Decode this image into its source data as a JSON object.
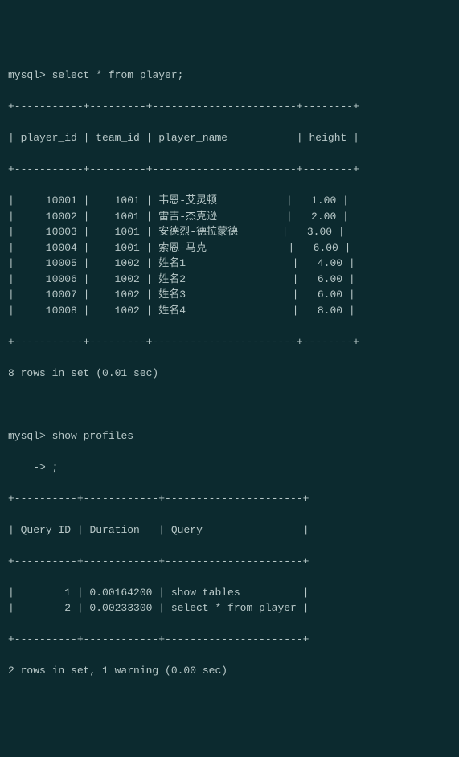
{
  "prompt": "mysql>",
  "continuation": "    ->",
  "queries": {
    "q1": "select * from player;",
    "q2": "show profiles",
    "q2_cont": ";"
  },
  "table1": {
    "headers": {
      "c1": "player_id",
      "c2": "team_id",
      "c3": "player_name",
      "c4": "height"
    },
    "rows": [
      {
        "c1": "10001",
        "c2": "1001",
        "c3": "韦恩-艾灵顿",
        "c4": "1.00"
      },
      {
        "c1": "10002",
        "c2": "1001",
        "c3": "雷吉-杰克逊",
        "c4": "2.00"
      },
      {
        "c1": "10003",
        "c2": "1001",
        "c3": "安德烈-德拉蒙德",
        "c4": "3.00"
      },
      {
        "c1": "10004",
        "c2": "1001",
        "c3": "索恩-马克",
        "c4": "6.00"
      },
      {
        "c1": "10005",
        "c2": "1002",
        "c3": "姓名1",
        "c4": "4.00"
      },
      {
        "c1": "10006",
        "c2": "1002",
        "c3": "姓名2",
        "c4": "6.00"
      },
      {
        "c1": "10007",
        "c2": "1002",
        "c3": "姓名3",
        "c4": "6.00"
      },
      {
        "c1": "10008",
        "c2": "1002",
        "c3": "姓名4",
        "c4": "8.00"
      }
    ],
    "summary": "8 rows in set (0.01 sec)"
  },
  "table2": {
    "headers": {
      "c1": "Query_ID",
      "c2": "Duration",
      "c3": "Query"
    },
    "rows": [
      {
        "c1": "1",
        "c2": "0.00164200",
        "c3": "show tables"
      },
      {
        "c1": "2",
        "c2": "0.00233300",
        "c3": "select * from player"
      }
    ],
    "summary": "2 rows in set, 1 warning (0.00 sec)"
  },
  "chart_data": {
    "type": "table",
    "tables": [
      {
        "title": "player",
        "columns": [
          "player_id",
          "team_id",
          "player_name",
          "height"
        ],
        "rows": [
          [
            10001,
            1001,
            "韦恩-艾灵顿",
            1.0
          ],
          [
            10002,
            1001,
            "雷吉-杰克逊",
            2.0
          ],
          [
            10003,
            1001,
            "安德烈-德拉蒙德",
            3.0
          ],
          [
            10004,
            1001,
            "索恩-马克",
            6.0
          ],
          [
            10005,
            1002,
            "姓名1",
            4.0
          ],
          [
            10006,
            1002,
            "姓名2",
            6.0
          ],
          [
            10007,
            1002,
            "姓名3",
            6.0
          ],
          [
            10008,
            1002,
            "姓名4",
            8.0
          ]
        ]
      },
      {
        "title": "profiles",
        "columns": [
          "Query_ID",
          "Duration",
          "Query"
        ],
        "rows": [
          [
            1,
            0.001642,
            "show tables"
          ],
          [
            2,
            0.002333,
            "select * from player"
          ]
        ]
      }
    ]
  }
}
